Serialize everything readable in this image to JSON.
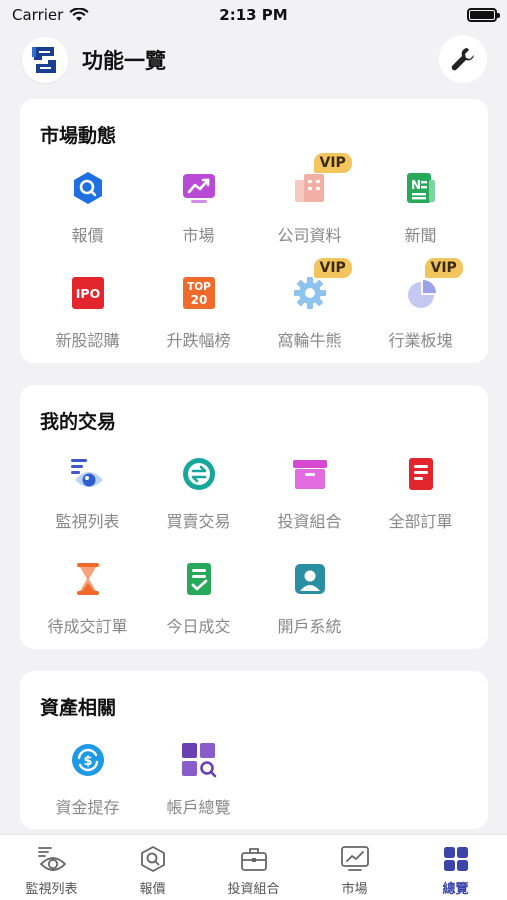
{
  "status_bar": {
    "carrier": "Carrier",
    "time": "2:13 PM"
  },
  "header": {
    "title": "功能一覽",
    "logo_icon": "app-logo-icon",
    "settings_icon": "wrench-icon"
  },
  "sections": [
    {
      "title": "市場動態",
      "items": [
        {
          "label": "報價",
          "icon": "quote-search-icon",
          "vip": false
        },
        {
          "label": "市場",
          "icon": "market-chart-icon",
          "vip": false
        },
        {
          "label": "公司資料",
          "icon": "company-info-icon",
          "vip": true,
          "badge": "VIP"
        },
        {
          "label": "新聞",
          "icon": "news-icon",
          "vip": false
        },
        {
          "label": "新股認購",
          "icon": "ipo-icon",
          "vip": false,
          "icon_text": "IPO"
        },
        {
          "label": "升跌幅榜",
          "icon": "top20-icon",
          "vip": false,
          "icon_text_1": "TOP",
          "icon_text_2": "20"
        },
        {
          "label": "窩輪牛熊",
          "icon": "warrant-gear-icon",
          "vip": true,
          "badge": "VIP"
        },
        {
          "label": "行業板塊",
          "icon": "sector-pie-icon",
          "vip": true,
          "badge": "VIP"
        }
      ]
    },
    {
      "title": "我的交易",
      "items": [
        {
          "label": "監視列表",
          "icon": "watchlist-eye-icon"
        },
        {
          "label": "買賣交易",
          "icon": "trade-exchange-icon"
        },
        {
          "label": "投資組合",
          "icon": "portfolio-box-icon"
        },
        {
          "label": "全部訂單",
          "icon": "all-orders-icon"
        },
        {
          "label": "待成交訂單",
          "icon": "pending-hourglass-icon"
        },
        {
          "label": "今日成交",
          "icon": "today-done-icon"
        },
        {
          "label": "開戶系統",
          "icon": "open-account-icon"
        }
      ]
    },
    {
      "title": "資產相關",
      "items": [
        {
          "label": "資金提存",
          "icon": "fund-transfer-icon"
        },
        {
          "label": "帳戶總覽",
          "icon": "account-overview-icon"
        }
      ]
    }
  ],
  "tab_bar": [
    {
      "label": "監視列表",
      "icon": "watchlist-tab-icon",
      "active": false
    },
    {
      "label": "報價",
      "icon": "quote-tab-icon",
      "active": false
    },
    {
      "label": "投資組合",
      "icon": "portfolio-tab-icon",
      "active": false
    },
    {
      "label": "市場",
      "icon": "market-tab-icon",
      "active": false
    },
    {
      "label": "總覽",
      "icon": "overview-grid-icon",
      "active": true
    }
  ],
  "colors": {
    "accent": "#3b44a8",
    "vip": "#f2c55f",
    "card": "#ffffff",
    "background": "#f2f2f4"
  }
}
